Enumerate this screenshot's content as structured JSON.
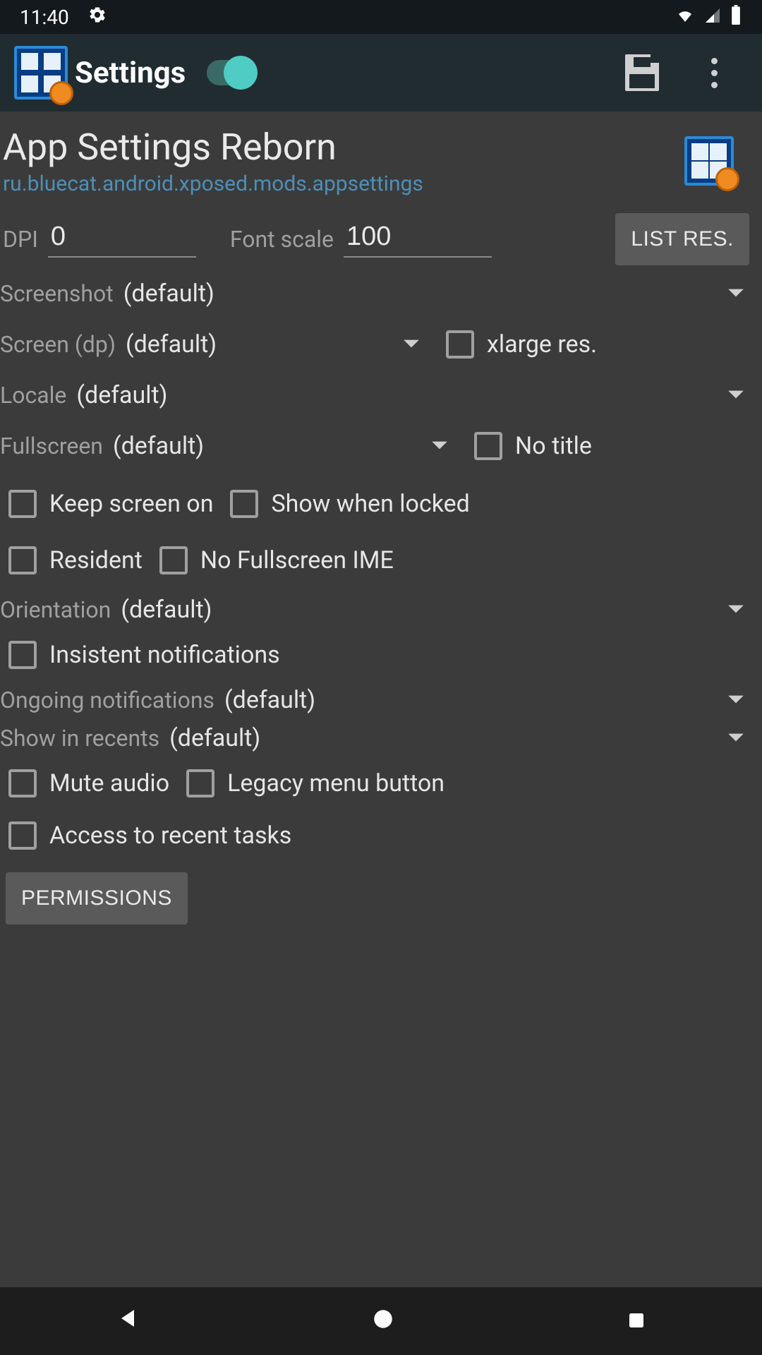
{
  "statusbar": {
    "time": "11:40"
  },
  "appbar": {
    "title": "Settings"
  },
  "header": {
    "app_name": "App Settings Reborn",
    "package": "ru.bluecat.android.xposed.mods.appsettings"
  },
  "inputs": {
    "dpi_label": "DPI",
    "dpi_value": "0",
    "fontscale_label": "Font scale",
    "fontscale_value": "100",
    "list_res_btn": "LIST RES."
  },
  "selects": {
    "screenshot_label": "Screenshot",
    "screenshot_value": "(default)",
    "screendp_label": "Screen (dp)",
    "screendp_value": "(default)",
    "xlarge_label": "xlarge res.",
    "locale_label": "Locale",
    "locale_value": "(default)",
    "fullscreen_label": "Fullscreen",
    "fullscreen_value": "(default)",
    "notitle_label": "No title",
    "orientation_label": "Orientation",
    "orientation_value": "(default)",
    "ongoing_label": "Ongoing notifications",
    "ongoing_value": "(default)",
    "recents_label": "Show in recents",
    "recents_value": "(default)"
  },
  "checks": {
    "keep_screen_on": "Keep screen on",
    "show_when_locked": "Show when locked",
    "resident": "Resident",
    "no_fullscreen_ime": "No Fullscreen IME",
    "insistent_notifications": "Insistent notifications",
    "mute_audio": "Mute audio",
    "legacy_menu": "Legacy menu button",
    "access_recent_tasks": "Access to recent tasks"
  },
  "buttons": {
    "permissions": "PERMISSIONS"
  }
}
